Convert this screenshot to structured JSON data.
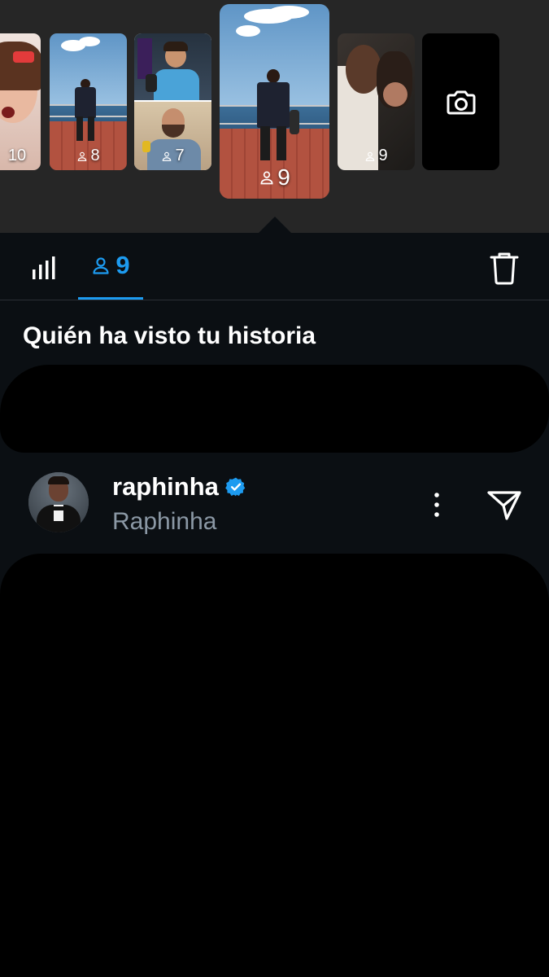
{
  "stories": [
    {
      "count": "10"
    },
    {
      "count": "8"
    },
    {
      "count": "7"
    },
    {
      "count": "9",
      "selected": true
    },
    {
      "count": "9"
    }
  ],
  "camera": {
    "icon": "camera-icon"
  },
  "tabs": {
    "stats_icon": "bar-chart-icon",
    "viewers_icon": "people-icon",
    "viewers_count": "9",
    "delete_icon": "trash-icon"
  },
  "section_title": "Quién ha visto tu historia",
  "viewer": {
    "name": "raphinha",
    "handle": "Raphinha",
    "verified_icon": "verified-badge-icon",
    "more_icon": "more-vertical-icon",
    "send_icon": "send-icon"
  },
  "colors": {
    "accent": "#1d9bf0",
    "background": "#0b0f13",
    "strip": "#262626",
    "secondary_text": "#8b98a5"
  }
}
